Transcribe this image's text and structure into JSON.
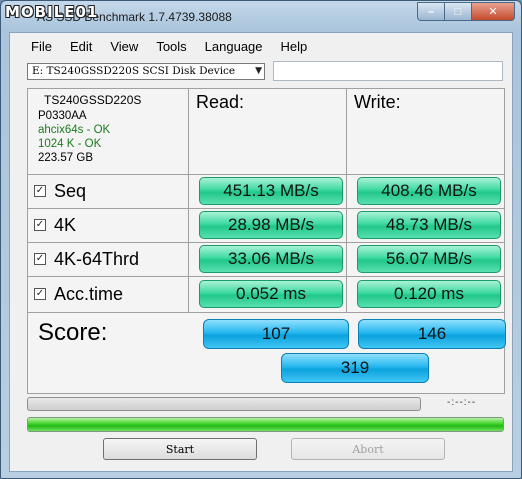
{
  "window": {
    "watermark": "MOBILE01",
    "title": "AS SSD Benchmark 1.7.4739.38088",
    "controls": [
      "–",
      "□",
      "✕"
    ]
  },
  "menu": [
    "File",
    "Edit",
    "View",
    "Tools",
    "Language",
    "Help"
  ],
  "drive": {
    "selected": "E:  TS240GSSD220S SCSI Disk Device",
    "arrow": "▼"
  },
  "info": {
    "model": "TS240GSSD220S",
    "firmware": "P0330AA",
    "driver": "ahcix64s - OK",
    "alignment": "1024 K - OK",
    "capacity": "223.57 GB"
  },
  "headers": {
    "read": "Read:",
    "write": "Write:"
  },
  "tests": [
    {
      "label": "Seq",
      "checked": true,
      "read": "451.13 MB/s",
      "write": "408.46 MB/s"
    },
    {
      "label": "4K",
      "checked": true,
      "read": "28.98 MB/s",
      "write": "48.73 MB/s"
    },
    {
      "label": "4K-64Thrd",
      "checked": true,
      "read": "33.06 MB/s",
      "write": "56.07 MB/s"
    },
    {
      "label": "Acc.time",
      "checked": true,
      "read": "0.052 ms",
      "write": "0.120 ms"
    }
  ],
  "score": {
    "label": "Score:",
    "read": "107",
    "write": "146",
    "total": "319"
  },
  "progress": {
    "time": "-:--:--",
    "overall_fraction": 1.0
  },
  "buttons": {
    "start": "Start",
    "abort": "Abort"
  }
}
